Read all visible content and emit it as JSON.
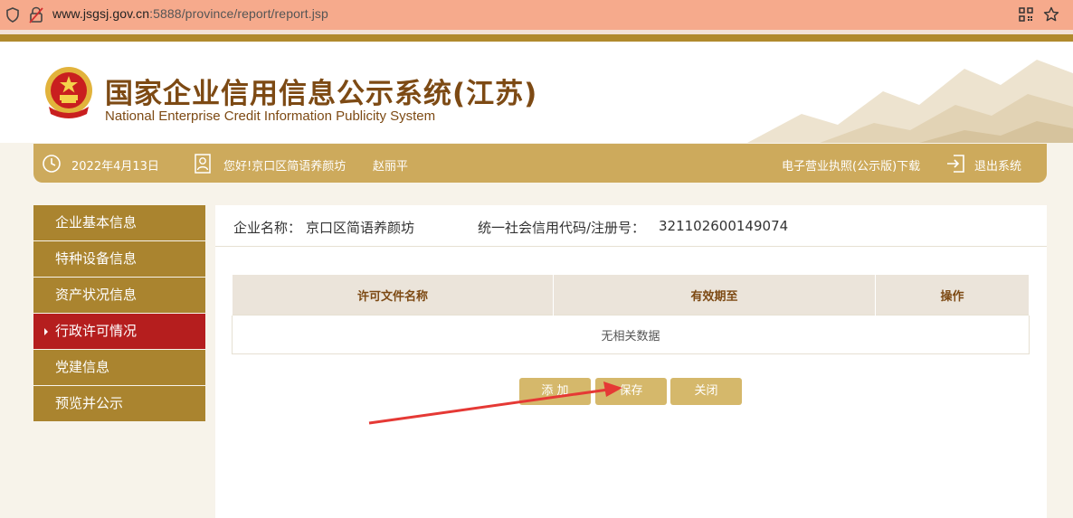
{
  "browser": {
    "url_host": "www.jsgsj.gov.cn",
    "url_path": ":5888/province/report/report.jsp"
  },
  "header": {
    "title_cn": "国家企业信用信息公示系统(江苏)",
    "title_en": "National Enterprise Credit Information Publicity System"
  },
  "goldbar": {
    "date": "2022年4月13日",
    "greeting": "您好!京口区简语养颜坊",
    "user": "赵丽平",
    "license_download": "电子营业执照(公示版)下载",
    "logout": "退出系统"
  },
  "sidebar": {
    "items": [
      {
        "label": "企业基本信息"
      },
      {
        "label": "特种设备信息"
      },
      {
        "label": "资产状况信息"
      },
      {
        "label": "行政许可情况",
        "active": true
      },
      {
        "label": "党建信息"
      },
      {
        "label": "预览并公示"
      }
    ]
  },
  "main": {
    "company_name_label": "企业名称：",
    "company_name": "京口区简语养颜坊",
    "credit_code_label": "统一社会信用代码/注册号：",
    "credit_code": "321102600149074",
    "table": {
      "columns": [
        "许可文件名称",
        "有效期至",
        "操作"
      ],
      "empty_text": "无相关数据"
    },
    "buttons": {
      "add": "添 加",
      "save": "保存",
      "close": "关闭"
    }
  },
  "colors": {
    "gold": "#cdaa5c",
    "nav": "#aa842f",
    "active": "#b51e1e",
    "annotation_arrow": "#e53935"
  }
}
